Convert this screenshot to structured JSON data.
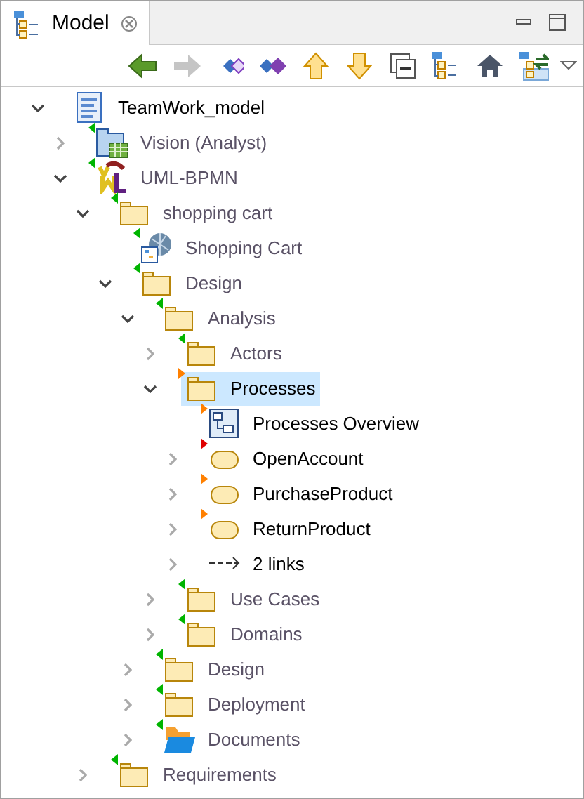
{
  "tab": {
    "label": "Model",
    "selected": true
  },
  "toolbar": [
    {
      "kind": "back",
      "disabled": false
    },
    {
      "kind": "forward",
      "disabled": true
    },
    {
      "kind": "diamond-outline",
      "disabled": false
    },
    {
      "kind": "diamond-filled",
      "disabled": false
    },
    {
      "kind": "up",
      "disabled": false
    },
    {
      "kind": "down",
      "disabled": false
    },
    {
      "kind": "collapse",
      "disabled": false
    },
    {
      "kind": "tree",
      "disabled": false
    },
    {
      "kind": "home",
      "disabled": false
    },
    {
      "kind": "link",
      "disabled": false
    }
  ],
  "tree": [
    {
      "label": "TeamWork_model",
      "kind": "model",
      "expanded": true,
      "dimmed": false,
      "selected": false,
      "children": [
        {
          "label": "Vision (Analyst)",
          "kind": "vision",
          "expanded": false,
          "dimmed": true,
          "selected": false,
          "marker": {
            "kind": "in",
            "color": "#00b400"
          }
        },
        {
          "label": "UML-BPMN",
          "kind": "uml",
          "expanded": true,
          "dimmed": true,
          "selected": false,
          "marker": {
            "kind": "in",
            "color": "#00b400"
          },
          "children": [
            {
              "label": "shopping cart",
              "kind": "folder",
              "expanded": true,
              "dimmed": true,
              "selected": false,
              "marker": {
                "kind": "in",
                "color": "#00b400"
              },
              "children": [
                {
                  "label": "Shopping Cart",
                  "kind": "globe-diagram",
                  "dimmed": true,
                  "selected": false,
                  "marker": {
                    "kind": "in",
                    "color": "#00b400"
                  }
                },
                {
                  "label": "Design",
                  "kind": "folder",
                  "expanded": true,
                  "dimmed": true,
                  "selected": false,
                  "marker": {
                    "kind": "in",
                    "color": "#00b400"
                  },
                  "children": [
                    {
                      "label": "Analysis",
                      "kind": "folder",
                      "expanded": true,
                      "dimmed": true,
                      "selected": false,
                      "marker": {
                        "kind": "in",
                        "color": "#00b400"
                      },
                      "children": [
                        {
                          "label": "Actors",
                          "kind": "folder",
                          "expanded": false,
                          "dimmed": true,
                          "selected": false,
                          "marker": {
                            "kind": "in",
                            "color": "#00b400"
                          }
                        },
                        {
                          "label": "Processes",
                          "kind": "folder",
                          "expanded": true,
                          "dimmed": false,
                          "selected": true,
                          "marker": {
                            "kind": "out",
                            "color": "#ff8000"
                          },
                          "children": [
                            {
                              "label": "Processes Overview",
                              "kind": "diagram",
                              "dimmed": false,
                              "selected": false,
                              "marker": {
                                "kind": "out",
                                "color": "#ff8000"
                              }
                            },
                            {
                              "label": "OpenAccount",
                              "kind": "process",
                              "expanded": false,
                              "dimmed": false,
                              "selected": false,
                              "marker": {
                                "kind": "out",
                                "color": "#e00000"
                              }
                            },
                            {
                              "label": "PurchaseProduct",
                              "kind": "process",
                              "expanded": false,
                              "dimmed": false,
                              "selected": false,
                              "marker": {
                                "kind": "out",
                                "color": "#ff8000"
                              }
                            },
                            {
                              "label": "ReturnProduct",
                              "kind": "process",
                              "expanded": false,
                              "dimmed": false,
                              "selected": false,
                              "marker": {
                                "kind": "out",
                                "color": "#ff8000"
                              }
                            },
                            {
                              "label": "2 links",
                              "kind": "link",
                              "expanded": false,
                              "dimmed": false,
                              "selected": false
                            }
                          ]
                        },
                        {
                          "label": "Use Cases",
                          "kind": "folder",
                          "expanded": false,
                          "dimmed": true,
                          "selected": false,
                          "marker": {
                            "kind": "in",
                            "color": "#00b400"
                          }
                        },
                        {
                          "label": "Domains",
                          "kind": "folder",
                          "expanded": false,
                          "dimmed": true,
                          "selected": false,
                          "marker": {
                            "kind": "in",
                            "color": "#00b400"
                          }
                        }
                      ]
                    },
                    {
                      "label": "Design",
                      "kind": "folder",
                      "expanded": false,
                      "dimmed": true,
                      "selected": false,
                      "marker": {
                        "kind": "in",
                        "color": "#00b400"
                      }
                    },
                    {
                      "label": "Deployment",
                      "kind": "folder",
                      "expanded": false,
                      "dimmed": true,
                      "selected": false,
                      "marker": {
                        "kind": "in",
                        "color": "#00b400"
                      }
                    },
                    {
                      "label": "Documents",
                      "kind": "documents",
                      "expanded": false,
                      "dimmed": true,
                      "selected": false,
                      "marker": {
                        "kind": "in",
                        "color": "#00b400"
                      }
                    }
                  ]
                }
              ]
            },
            {
              "label": "Requirements",
              "kind": "folder",
              "expanded": false,
              "dimmed": true,
              "selected": false,
              "marker": {
                "kind": "in",
                "color": "#00b400"
              }
            }
          ]
        }
      ]
    }
  ]
}
